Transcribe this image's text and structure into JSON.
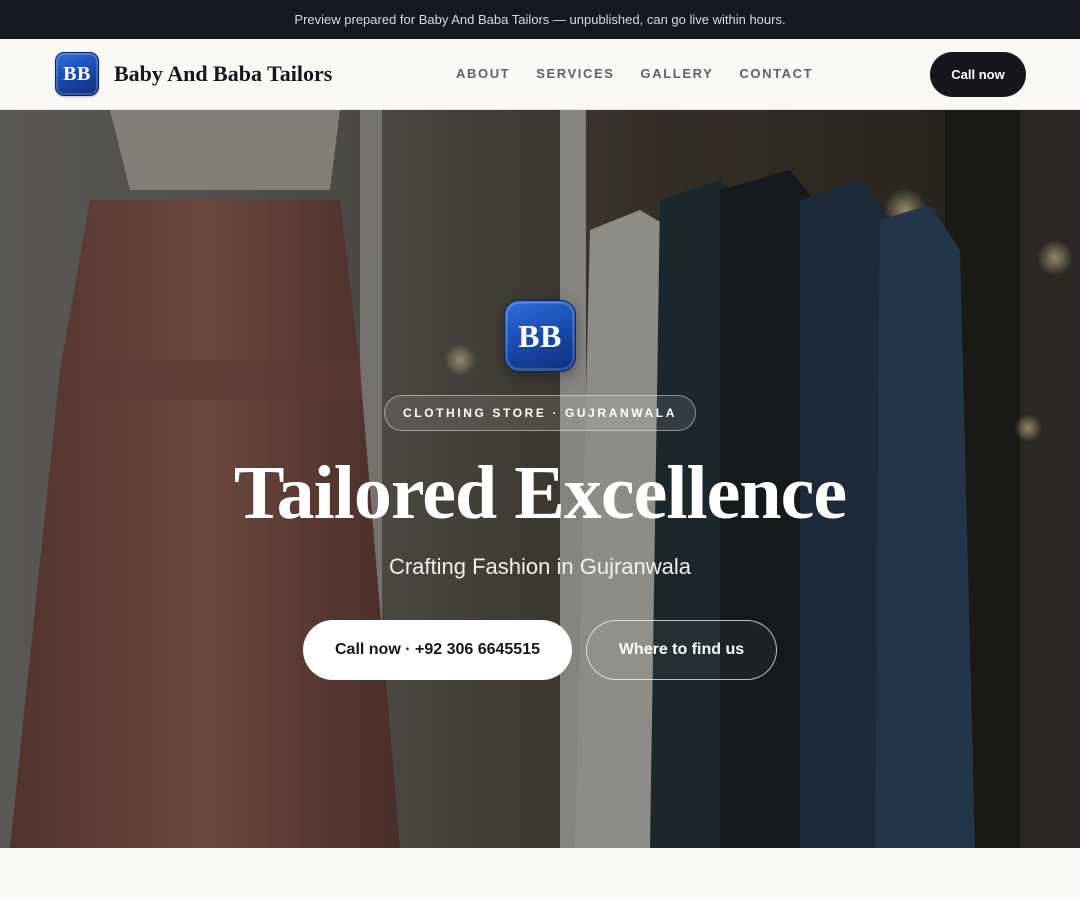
{
  "preview_banner": {
    "text": "Preview prepared for Baby And Baba Tailors — unpublished, can go live within hours."
  },
  "header": {
    "logo_initials": "BB",
    "brand_name": "Baby And Baba Tailors",
    "nav": [
      {
        "label": "ABOUT"
      },
      {
        "label": "SERVICES"
      },
      {
        "label": "GALLERY"
      },
      {
        "label": "CONTACT"
      }
    ],
    "cta_label": "Call now"
  },
  "hero": {
    "badge_initials": "BB",
    "category_pill": "CLOTHING STORE · GUJRANWALA",
    "title": "Tailored Excellence",
    "subtitle": "Crafting Fashion in Gujranwala",
    "primary_button": "Call now · +92 306 6645515",
    "secondary_button": "Where to find us"
  },
  "colors": {
    "dark": "#15171c",
    "brand_blue": "#1747a8",
    "page_bg": "#faf9f6",
    "banner_bg": "#15181f"
  }
}
